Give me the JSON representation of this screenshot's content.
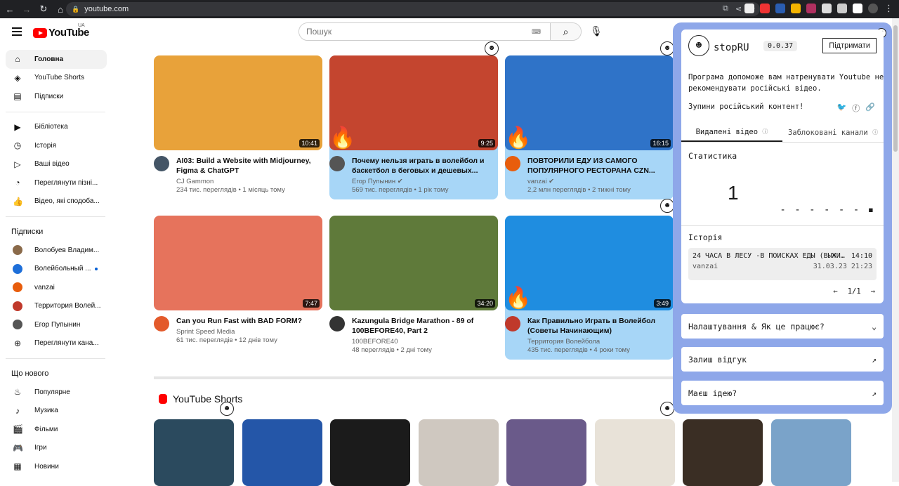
{
  "browser": {
    "url": "youtube.com"
  },
  "header": {
    "logo": "YouTube",
    "country": "UA",
    "search_placeholder": "Пошук"
  },
  "sidebar": {
    "main": [
      {
        "label": "Головна",
        "icon": "home-icon",
        "active": true
      },
      {
        "label": "YouTube Shorts",
        "icon": "shorts-icon"
      },
      {
        "label": "Підписки",
        "icon": "subscriptions-icon"
      }
    ],
    "library": [
      {
        "label": "Бібліотека",
        "icon": "library-icon"
      },
      {
        "label": "Історія",
        "icon": "history-icon"
      },
      {
        "label": "Ваші відео",
        "icon": "your-videos-icon"
      },
      {
        "label": "Переглянути пізні...",
        "icon": "watch-later-icon"
      },
      {
        "label": "Відео, які сподоба...",
        "icon": "liked-icon"
      }
    ],
    "subs_title": "Підписки",
    "subs": [
      {
        "label": "Волобуев Владим...",
        "color": "#8a6a4a"
      },
      {
        "label": "Волейбольный ...",
        "color": "#1e6fd9",
        "dot": true
      },
      {
        "label": "vanzai",
        "color": "#e85d0c"
      },
      {
        "label": "Территория Волей...",
        "color": "#c0392b"
      },
      {
        "label": "Егор Пупынин",
        "color": "#555555"
      },
      {
        "label": "Переглянути кана...",
        "icon": "plus-icon"
      }
    ],
    "new_title": "Що нового",
    "new": [
      {
        "label": "Популярне",
        "icon": "trending-icon"
      },
      {
        "label": "Музика",
        "icon": "music-icon"
      },
      {
        "label": "Фільми",
        "icon": "movies-icon"
      },
      {
        "label": "Ігри",
        "icon": "games-icon"
      },
      {
        "label": "Новини",
        "icon": "news-icon"
      }
    ]
  },
  "videos": [
    {
      "title": "AI03: Build a Website with Midjourney, Figma & ChatGPT",
      "channel": "CJ Gammon",
      "views": "234 тис. переглядів • 1 місяць тому",
      "duration": "10:41",
      "thumb": "#e8a23a",
      "avatar": "#445566",
      "hl": false
    },
    {
      "title": "Почему нельзя играть в волейбол и баскетбол в беговых и дешевых...",
      "channel": "Егор Пупынин ✔",
      "views": "569 тис. переглядів • 1 рік тому",
      "duration": "9:25",
      "thumb": "#c4452f",
      "avatar": "#555555",
      "hl": true,
      "fire": true
    },
    {
      "title": "ПОВТОРИЛИ ЕДУ ИЗ САМОГО ПОПУЛЯРНОГО РЕСТОРАНА CZN...",
      "channel": "vanzai ✔",
      "views": "2,2 млн переглядів • 2 тижні тому",
      "duration": "16:15",
      "thumb": "#2f73c8",
      "avatar": "#e85d0c",
      "hl": true,
      "fire": true
    },
    {
      "title": "Can you Run Fast with BAD FORM?",
      "channel": "Sprint Speed Media",
      "views": "61 тис. переглядів • 12 днів тому",
      "duration": "7:47",
      "thumb": "#e6735c",
      "avatar": "#e35a2b",
      "hl": false
    },
    {
      "title": "Kazungula Bridge Marathon - 89 of 100BEFORE40, Part 2",
      "channel": "100BEFORE40",
      "views": "48 переглядів • 2 дні тому",
      "duration": "34:20",
      "thumb": "#5f7a3a",
      "avatar": "#333333",
      "hl": false
    },
    {
      "title": "Как Правильно Играть в Волейбол (Советы Начинающим)",
      "channel": "Территория Волейбола",
      "views": "435 тис. переглядів • 4 роки тому",
      "duration": "3:49",
      "thumb": "#1f8de0",
      "avatar": "#c0392b",
      "hl": true,
      "fire": true
    }
  ],
  "shorts": {
    "title": "YouTube Shorts",
    "colors": [
      "#2b4a5e",
      "#2456a8",
      "#1b1b1b",
      "#cfc8c0",
      "#6a5a8a",
      "#e8e2d8",
      "#3a2e24",
      "#7aa3c9"
    ]
  },
  "panel": {
    "name": "stopRU",
    "version": "0.0.37",
    "support": "Підтримати",
    "desc": "Програма допоможе вам натренувати Youtube не рекомендувати російські відео.",
    "stop": "Зупини російський контент!",
    "tab1": "Видалені відео",
    "tab2": "Заблоковані канали",
    "stats_title": "Статистика",
    "stats_value": "1",
    "history_title": "Історія",
    "history_item": "24 ЧАСА В ЛЕСУ -В ПОИСКАХ ЕДЫ (ВЫЖИ…",
    "history_time": "14:10",
    "history_channel": "vanzai",
    "history_date": "31.03.23 21:23",
    "pager": "1/1",
    "settings": "Налаштування & Як це працює?",
    "feedback": "Залиш відгук",
    "idea": "Маєш ідею?"
  }
}
